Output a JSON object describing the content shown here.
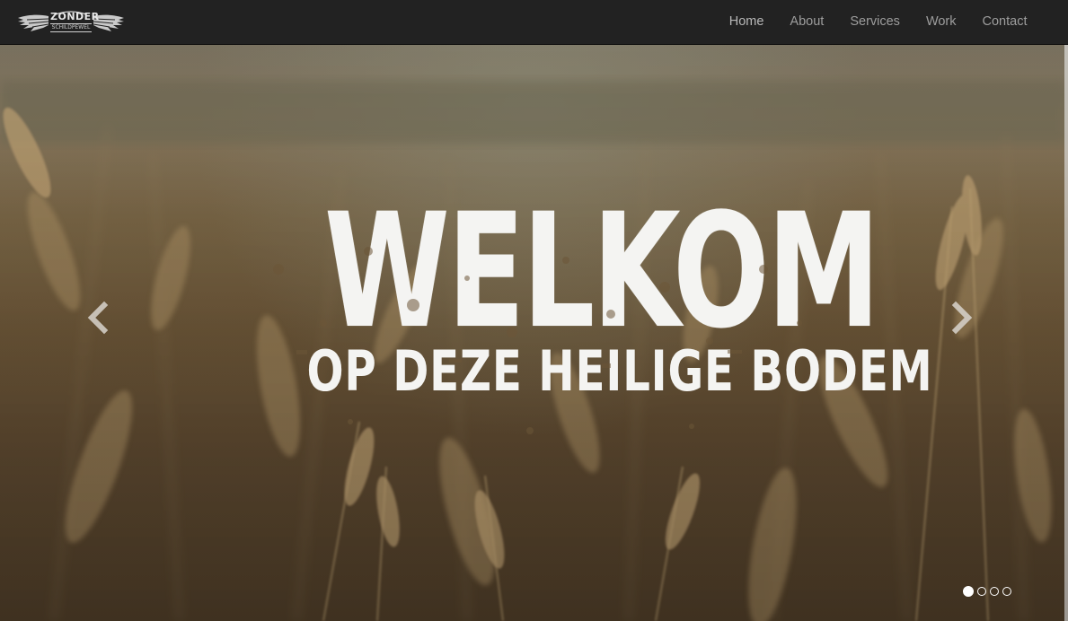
{
  "brand": {
    "logo_text_top": "ZONDER",
    "logo_text_bottom": "SCHILDPEWEL"
  },
  "nav": {
    "items": [
      {
        "label": "Home"
      },
      {
        "label": "About"
      },
      {
        "label": "Services"
      },
      {
        "label": "Work"
      },
      {
        "label": "Contact"
      }
    ]
  },
  "hero": {
    "headline": "WELKOM",
    "subheadline": "OP DEZE HEILIGE BODEM",
    "prev_icon": "chevron-left-icon",
    "next_icon": "chevron-right-icon",
    "slides": 4,
    "active_slide": 1
  },
  "colors": {
    "navbar_bg": "#222222",
    "nav_text": "#9d9d9d",
    "headline_text": "#f4f4f2",
    "hero_tone": "#7c6848"
  }
}
